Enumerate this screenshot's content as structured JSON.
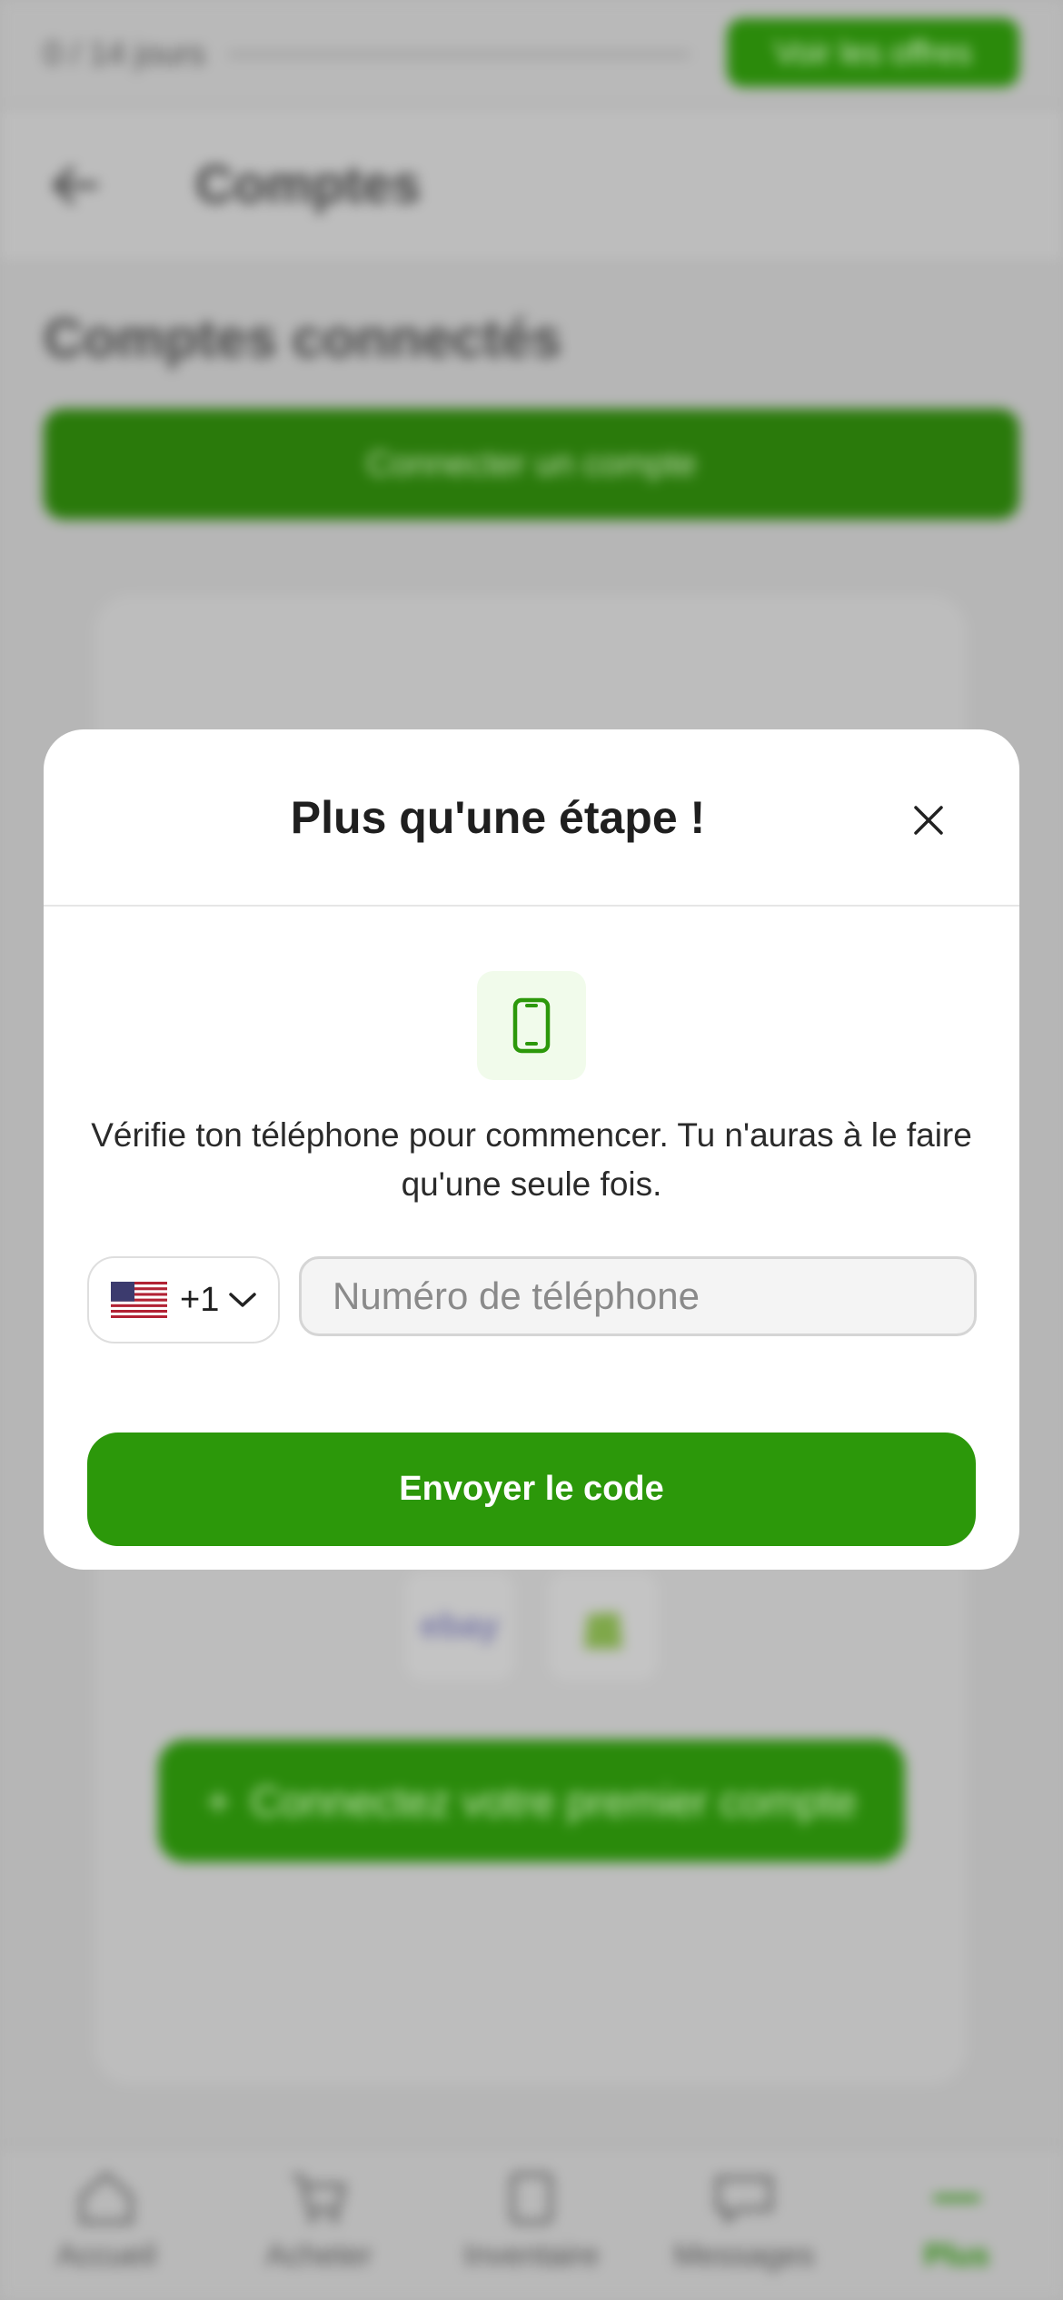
{
  "background": {
    "trial_text": "0 / 14 jours",
    "offers_button": "Voir les offres",
    "nav_title": "Comptes",
    "section_title": "Comptes connectés",
    "connect_button": "Connecter un compte",
    "marketplace_logos": [
      "ebay",
      "shopify"
    ],
    "first_account_button": "Connectez votre premier compte",
    "bottom_nav": [
      {
        "label": "Accueil",
        "icon": "home-icon"
      },
      {
        "label": "Acheter",
        "icon": "cart-icon"
      },
      {
        "label": "Inventaire",
        "icon": "inventory-icon"
      },
      {
        "label": "Messages",
        "icon": "chat-icon"
      },
      {
        "label": "Plus",
        "icon": "more-icon",
        "active": true
      }
    ]
  },
  "modal": {
    "title": "Plus qu'une étape !",
    "close_icon": "close-icon",
    "phone_icon": "smartphone-icon",
    "description": "Vérifie ton téléphone pour commencer. Tu n'auras à le faire qu'une seule fois.",
    "country": {
      "flag": "us-flag-icon",
      "dial_code": "+1"
    },
    "phone_placeholder": "Numéro de téléphone",
    "phone_value": "",
    "submit_label": "Envoyer le code"
  },
  "colors": {
    "accent_green": "#2c980a",
    "overlay_gray": "#b3b3b3",
    "icon_tile_bg": "#f1fbeb"
  }
}
